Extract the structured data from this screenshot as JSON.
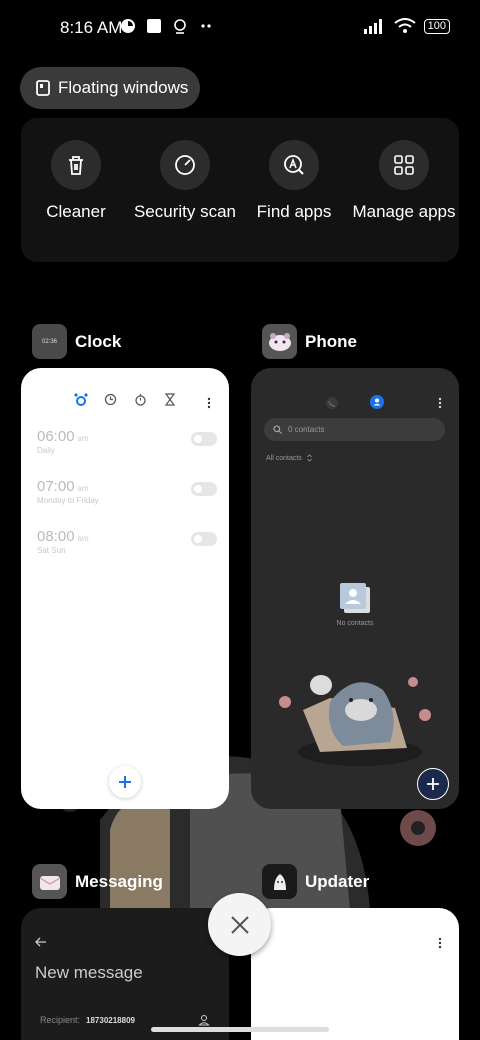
{
  "status_bar": {
    "time": "8:16 AM",
    "battery": "100"
  },
  "floating_windows": {
    "label": "Floating windows"
  },
  "quick_actions": [
    {
      "label": "Cleaner",
      "icon": "trash-icon"
    },
    {
      "label": "Security scan",
      "icon": "scan-icon"
    },
    {
      "label": "Find apps",
      "icon": "find-apps-icon"
    },
    {
      "label": "Manage apps",
      "icon": "grid-icon"
    }
  ],
  "apps": {
    "clock": {
      "name": "Clock",
      "icon_text": "02:36",
      "alarms": [
        {
          "time": "06:00",
          "ampm": "am",
          "repeat": "Daily"
        },
        {
          "time": "07:00",
          "ampm": "am",
          "repeat": "Monday to Friday"
        },
        {
          "time": "08:00",
          "ampm": "am",
          "repeat": "Sat Sun"
        }
      ]
    },
    "phone": {
      "name": "Phone",
      "search_placeholder": "0 contacts",
      "filter": "All contacts",
      "empty_text": "No contacts"
    },
    "messaging": {
      "name": "Messaging",
      "title": "New message",
      "recipient_label": "Recipient:",
      "recipient_value": "18730218809"
    },
    "updater": {
      "name": "Updater"
    }
  },
  "colors": {
    "accent_blue": "#1a73e8",
    "background": "#000000",
    "panel": "#121212"
  }
}
